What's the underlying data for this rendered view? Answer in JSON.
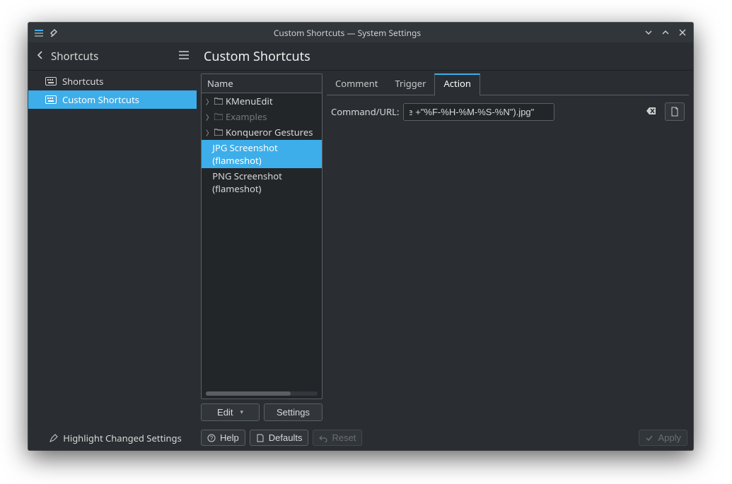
{
  "titlebar": {
    "title": "Custom Shortcuts — System Settings"
  },
  "header": {
    "breadcrumb": "Shortcuts",
    "page_title": "Custom Shortcuts"
  },
  "sidebar": {
    "items": [
      {
        "label": "Shortcuts",
        "selected": false
      },
      {
        "label": "Custom Shortcuts",
        "selected": true
      }
    ]
  },
  "tree": {
    "header": "Name",
    "rows": [
      {
        "label": "KMenuEdit",
        "kind": "folder",
        "dim": false
      },
      {
        "label": "Examples",
        "kind": "folder",
        "dim": true
      },
      {
        "label": "Konqueror Gestures",
        "kind": "folder",
        "dim": false
      },
      {
        "label": "JPG Screenshot (flameshot)",
        "kind": "item",
        "selected": true
      },
      {
        "label": "PNG Screenshot (flameshot)",
        "kind": "item",
        "selected": false
      }
    ],
    "buttons": {
      "edit": "Edit",
      "settings": "Settings"
    }
  },
  "tabs": {
    "items": [
      "Comment",
      "Trigger",
      "Action"
    ],
    "active": 2
  },
  "action_tab": {
    "label": "Command/URL:",
    "value": "r-dir DOCUMENTS)/Screenshots/$(date +\"%F-%H-%M-%S-%N\").jpg\""
  },
  "footer": {
    "highlight": "Highlight Changed Settings",
    "help": "Help",
    "defaults": "Defaults",
    "reset": "Reset",
    "apply": "Apply"
  }
}
